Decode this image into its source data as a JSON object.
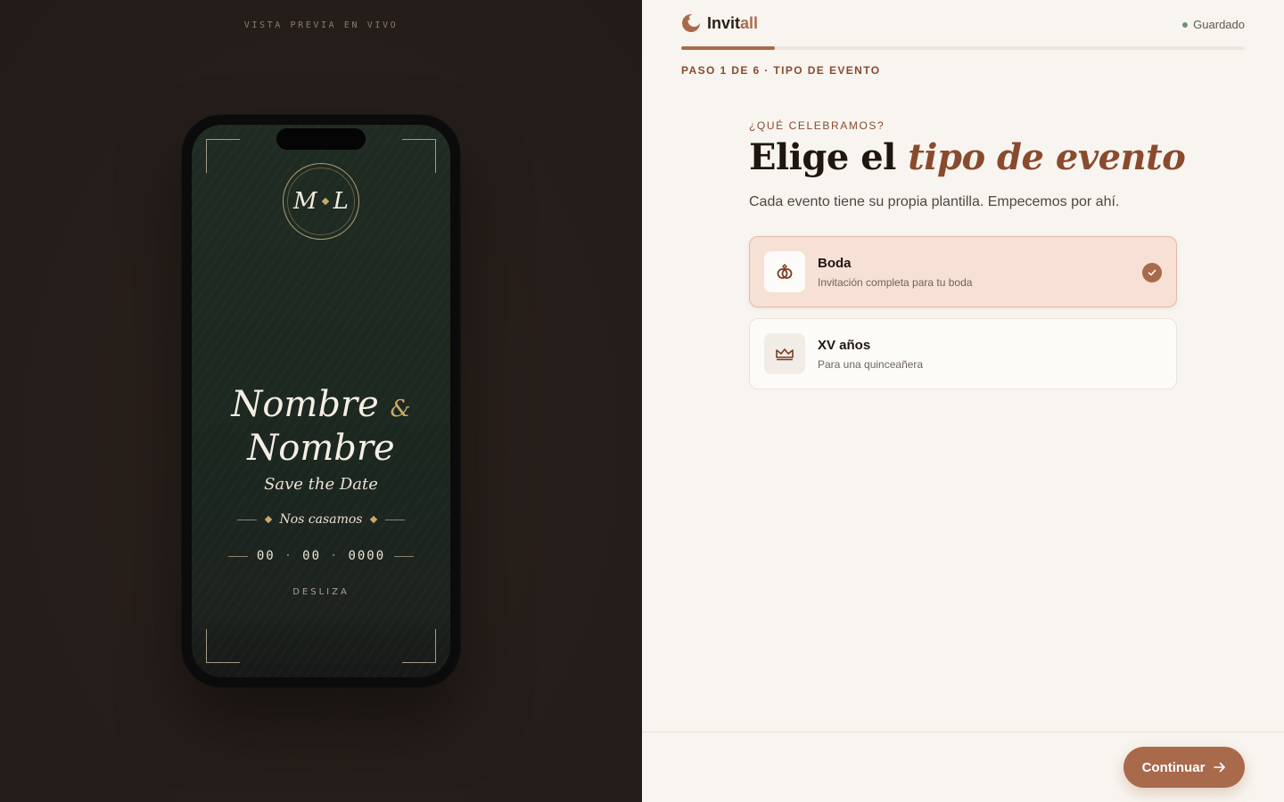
{
  "preview": {
    "label": "VISTA PREVIA EN VIVO",
    "invitation": {
      "monogram_left": "M",
      "monogram_right": "L",
      "name_1": "Nombre",
      "ampersand": "&",
      "name_2": "Nombre",
      "save_the_date": "Save the Date",
      "tagline": "Nos casamos",
      "date_day": "00",
      "date_month": "00",
      "date_year": "0000",
      "date_separator": "·",
      "scroll_hint": "DESLIZA"
    }
  },
  "header": {
    "brand_main": "Invit",
    "brand_accent": "all",
    "save_status": "Guardado",
    "progress_fraction": 0.1667,
    "step_label": "PASO 1 DE 6 · TIPO DE EVENTO"
  },
  "main": {
    "eyebrow": "¿QUÉ CELEBRAMOS?",
    "title_plain": "Elige el ",
    "title_emphasis": "tipo de evento",
    "subtitle": "Cada evento tiene su propia plantilla. Empecemos por ahí.",
    "options": [
      {
        "title": "Boda",
        "description": "Invitación completa para tu boda",
        "icon": "rings-icon",
        "selected": true
      },
      {
        "title": "XV años",
        "description": "Para una quinceañera",
        "icon": "crown-icon",
        "selected": false
      }
    ]
  },
  "footer": {
    "continue_label": "Continuar"
  },
  "colors": {
    "accent": "#a96a4c",
    "accent_dark": "#8a4a2e",
    "saved_dot": "#6e9278",
    "invite_green": "#1f2b23",
    "gold": "#c8a96a"
  }
}
